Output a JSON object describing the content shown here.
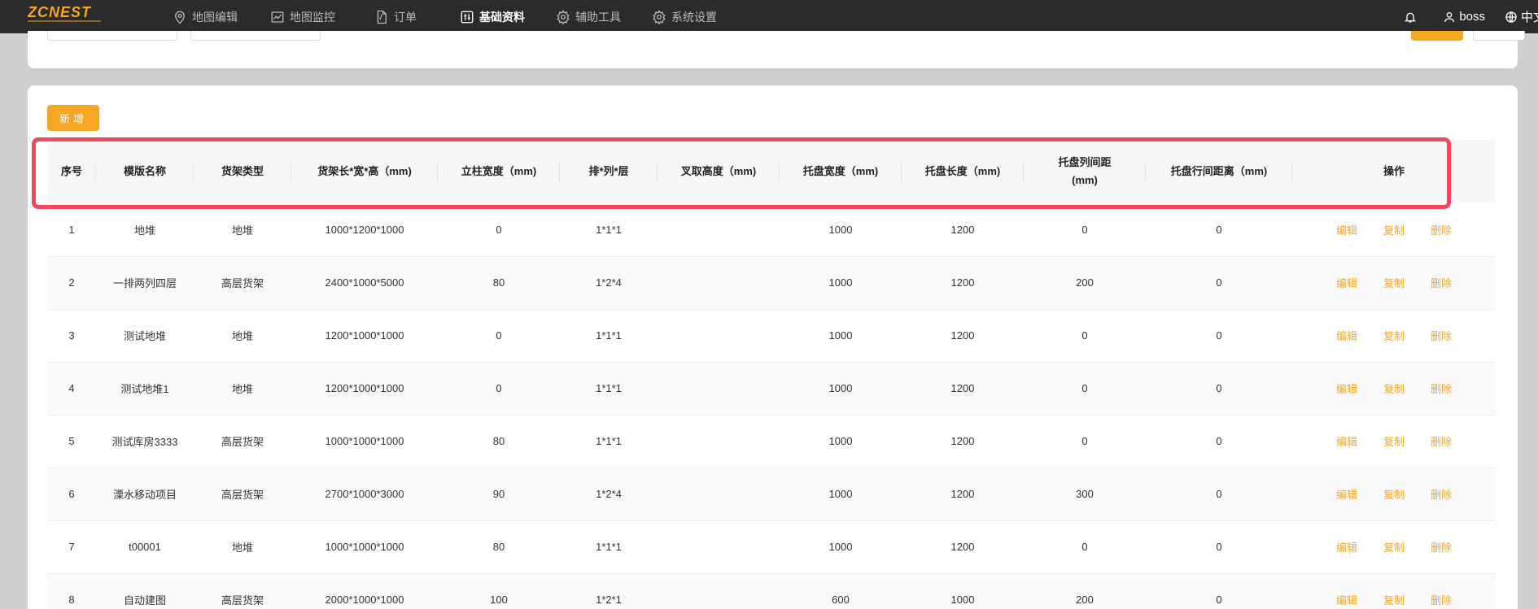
{
  "brand": {
    "logo_text": "ZCNEST",
    "accent": "#f5a623"
  },
  "nav": [
    {
      "label": "地图编辑",
      "icon": "map-pin-icon",
      "active": false
    },
    {
      "label": "地图监控",
      "icon": "chart-monitor-icon",
      "active": false
    },
    {
      "label": "订单",
      "icon": "document-icon",
      "active": false
    },
    {
      "label": "基础资料",
      "icon": "sliders-icon",
      "active": true
    },
    {
      "label": "辅助工具",
      "icon": "gear-icon",
      "active": false
    },
    {
      "label": "系统设置",
      "icon": "gear-icon",
      "active": false
    }
  ],
  "topbar_right": {
    "notification_icon": "bell-icon",
    "user": "boss",
    "language": "中文"
  },
  "actions": {
    "add_label": "新增"
  },
  "table": {
    "columns": [
      "序号",
      "模版名称",
      "货架类型",
      "货架长*宽*高（mm)",
      "立柱宽度（mm)",
      "排*列*层",
      "叉取高度（mm)",
      "托盘宽度（mm)",
      "托盘长度（mm)",
      "托盘列间距\n(mm)",
      "托盘行间距离（mm)",
      "操作"
    ],
    "row_actions": {
      "edit": "编辑",
      "copy": "复制",
      "delete": "删除"
    },
    "rows": [
      {
        "no": "1",
        "name": "地堆",
        "type": "地堆",
        "size": "1000*1200*1000",
        "column_width": "0",
        "layout": "1*1*1",
        "fork_height": "",
        "pallet_width": "1000",
        "pallet_length": "1200",
        "col_spacing": "0",
        "row_spacing": "0"
      },
      {
        "no": "2",
        "name": "一排两列四层",
        "type": "高层货架",
        "size": "2400*1000*5000",
        "column_width": "80",
        "layout": "1*2*4",
        "fork_height": "",
        "pallet_width": "1000",
        "pallet_length": "1200",
        "col_spacing": "200",
        "row_spacing": "0"
      },
      {
        "no": "3",
        "name": "测试地堆",
        "type": "地堆",
        "size": "1200*1000*1000",
        "column_width": "0",
        "layout": "1*1*1",
        "fork_height": "",
        "pallet_width": "1000",
        "pallet_length": "1200",
        "col_spacing": "0",
        "row_spacing": "0"
      },
      {
        "no": "4",
        "name": "测试地堆1",
        "type": "地堆",
        "size": "1200*1000*1000",
        "column_width": "0",
        "layout": "1*1*1",
        "fork_height": "",
        "pallet_width": "1000",
        "pallet_length": "1200",
        "col_spacing": "0",
        "row_spacing": "0"
      },
      {
        "no": "5",
        "name": "测试库房3333",
        "type": "高层货架",
        "size": "1000*1000*1000",
        "column_width": "80",
        "layout": "1*1*1",
        "fork_height": "",
        "pallet_width": "1000",
        "pallet_length": "1200",
        "col_spacing": "0",
        "row_spacing": "0"
      },
      {
        "no": "6",
        "name": "溧水移动项目",
        "type": "高层货架",
        "size": "2700*1000*3000",
        "column_width": "90",
        "layout": "1*2*4",
        "fork_height": "",
        "pallet_width": "1000",
        "pallet_length": "1200",
        "col_spacing": "300",
        "row_spacing": "0"
      },
      {
        "no": "7",
        "name": "t00001",
        "type": "地堆",
        "size": "1000*1000*1000",
        "column_width": "80",
        "layout": "1*1*1",
        "fork_height": "",
        "pallet_width": "1000",
        "pallet_length": "1200",
        "col_spacing": "0",
        "row_spacing": "0"
      },
      {
        "no": "8",
        "name": "自动建图",
        "type": "高层货架",
        "size": "2000*1000*1000",
        "column_width": "100",
        "layout": "1*2*1",
        "fork_height": "",
        "pallet_width": "600",
        "pallet_length": "1000",
        "col_spacing": "200",
        "row_spacing": "0"
      }
    ]
  }
}
